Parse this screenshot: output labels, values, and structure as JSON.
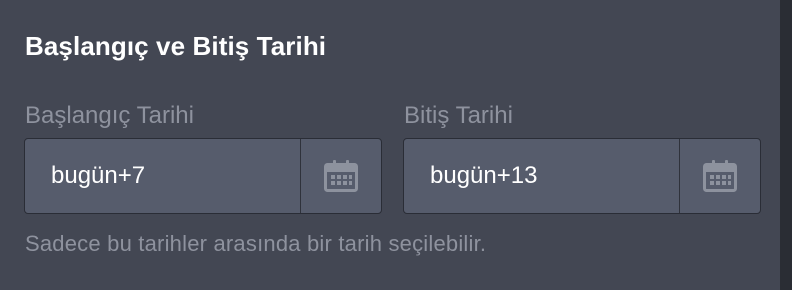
{
  "section": {
    "title": "Başlangıç ve Bitiş Tarihi"
  },
  "start_date": {
    "label": "Başlangıç Tarihi",
    "value": "bugün+7",
    "icon": "calendar-icon"
  },
  "end_date": {
    "label": "Bitiş Tarihi",
    "value": "bugün+13",
    "icon": "calendar-icon"
  },
  "hint": "Sadece bu tarihler arasında bir tarih seçilebilir.",
  "colors": {
    "panel_bg": "#434753",
    "field_bg": "#565c6c",
    "label": "#8e929e",
    "text": "#ffffff",
    "icon": "#8d929e"
  }
}
